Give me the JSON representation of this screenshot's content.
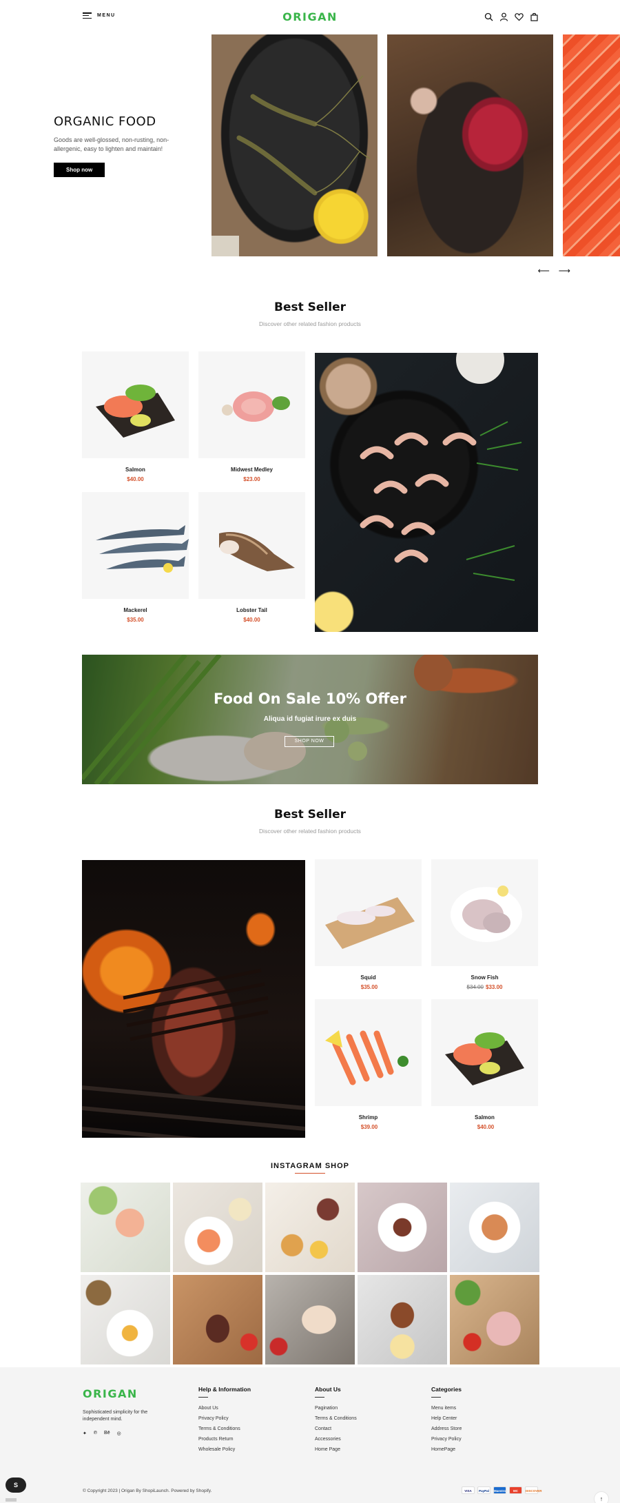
{
  "header": {
    "menu_label": "MENU",
    "logo": "ORIGAN",
    "icons": [
      "search-icon",
      "user-icon",
      "heart-icon",
      "bag-icon"
    ]
  },
  "hero": {
    "title": "ORGANIC FOOD",
    "description": "Goods are well-glossed, non-rusting, non-allergenic, easy to lighten and maintain!",
    "button": "Shop now",
    "arrow_prev": "⟵",
    "arrow_next": "⟶"
  },
  "best_seller_1": {
    "title": "Best Seller",
    "subtitle": "Discover other related fashion products",
    "products": [
      {
        "name": "Salmon",
        "price": "$40.00"
      },
      {
        "name": "Midwest Medley",
        "price": "$23.00"
      },
      {
        "name": "Mackerel",
        "price": "$35.00"
      },
      {
        "name": "Lobster Tail",
        "price": "$40.00"
      }
    ]
  },
  "banner": {
    "title": "Food On Sale 10% Offer",
    "subtitle": "Aliqua id fugiat irure ex duis",
    "button": "SHOP NOW"
  },
  "best_seller_2": {
    "title": "Best Seller",
    "subtitle": "Discover other related fashion products",
    "products": [
      {
        "name": "Squid",
        "price": "$35.00",
        "old_price": ""
      },
      {
        "name": "Snow Fish",
        "price": "$33.00",
        "old_price": "$34.00"
      },
      {
        "name": "Shrimp",
        "price": "$39.00",
        "old_price": ""
      },
      {
        "name": "Salmon",
        "price": "$40.00",
        "old_price": ""
      }
    ]
  },
  "instagram": {
    "title": "INSTAGRAM SHOP"
  },
  "footer": {
    "logo": "ORIGAN",
    "tagline": "Sophisticated simplicity for the independent mind.",
    "social": [
      "twitter-icon",
      "pinterest-icon",
      "behance-icon",
      "instagram-icon"
    ],
    "social_glyphs": [
      "✦",
      "℗",
      "Bē",
      "◎"
    ],
    "columns": [
      {
        "title": "Help & Information",
        "links": [
          "About Us",
          "Privacy Policy",
          "Terms & Conditions",
          "Products Return",
          "Wholesale Policy"
        ]
      },
      {
        "title": "About Us",
        "links": [
          "Pagination",
          "Terms & Conditions",
          "Contact",
          "Accessories",
          "Home Page"
        ]
      },
      {
        "title": "Categories",
        "links": [
          "Menu items",
          "Help Center",
          "Address Store",
          "Privacy Policy",
          "HomePage"
        ]
      }
    ],
    "copyright": "© Copyright 2023 | Origan By ShopiLaunch. Powered by Shopify.",
    "payments": [
      "VISA",
      "PayPal",
      "Maestro",
      "MC",
      "DISCOVER"
    ]
  },
  "to_top": "↑",
  "shopify_badge": "S",
  "colors": {
    "brand": "#3ab54a",
    "price": "#d4502a",
    "button": "#000000"
  }
}
